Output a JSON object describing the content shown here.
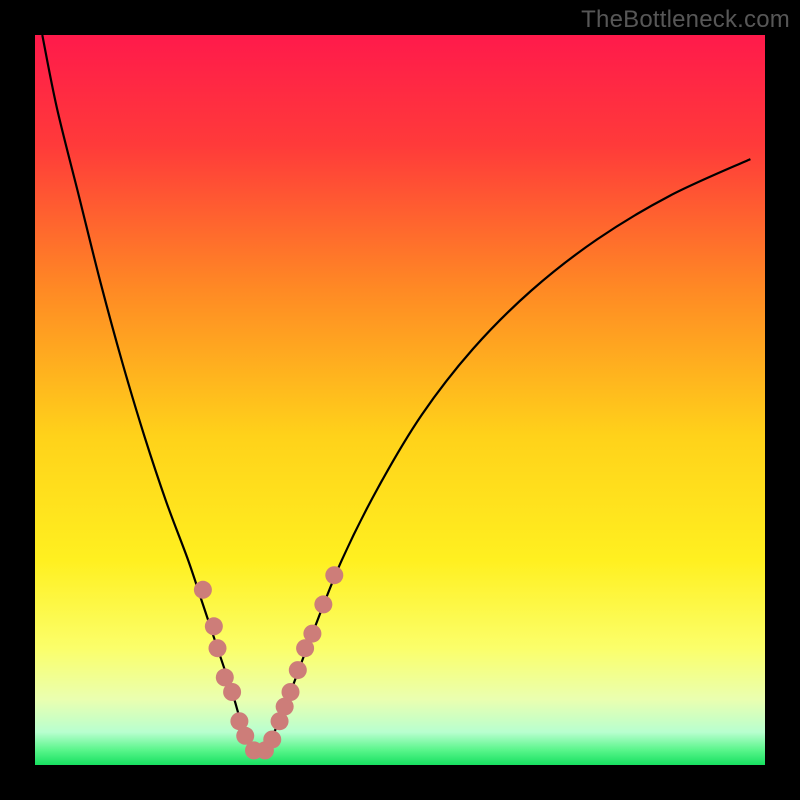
{
  "watermark": "TheBottleneck.com",
  "colors": {
    "frame": "#000000",
    "curve_stroke": "#000000",
    "marker_fill": "#cd7d79",
    "marker_stroke": "#cd7d79",
    "gradient_stops": [
      {
        "offset": 0.0,
        "color": "#ff1a4b"
      },
      {
        "offset": 0.15,
        "color": "#ff3a3a"
      },
      {
        "offset": 0.35,
        "color": "#ff8a24"
      },
      {
        "offset": 0.55,
        "color": "#ffd21a"
      },
      {
        "offset": 0.72,
        "color": "#fff020"
      },
      {
        "offset": 0.84,
        "color": "#fbff6a"
      },
      {
        "offset": 0.91,
        "color": "#eaffb0"
      },
      {
        "offset": 0.955,
        "color": "#b8ffcf"
      },
      {
        "offset": 0.98,
        "color": "#58f58a"
      },
      {
        "offset": 1.0,
        "color": "#17e060"
      }
    ]
  },
  "chart_data": {
    "type": "line",
    "title": "",
    "xlabel": "",
    "ylabel": "",
    "xlim": [
      0,
      100
    ],
    "ylim": [
      0,
      100
    ],
    "series": [
      {
        "name": "bottleneck-curve",
        "x": [
          1,
          3,
          6,
          9,
          12,
          15,
          18,
          21,
          23,
          25,
          27,
          28.5,
          30,
          31.5,
          33,
          35,
          38,
          42,
          47,
          53,
          60,
          68,
          77,
          87,
          98
        ],
        "y": [
          100,
          90,
          78,
          66,
          55,
          45,
          36,
          28,
          22,
          16,
          10,
          5,
          2,
          2,
          5,
          10,
          18,
          28,
          38,
          48,
          57,
          65,
          72,
          78,
          83
        ]
      }
    ],
    "markers": {
      "name": "highlighted-points",
      "points": [
        {
          "x": 23.0,
          "y": 24
        },
        {
          "x": 24.5,
          "y": 19
        },
        {
          "x": 25.0,
          "y": 16
        },
        {
          "x": 26.0,
          "y": 12
        },
        {
          "x": 27.0,
          "y": 10
        },
        {
          "x": 28.0,
          "y": 6
        },
        {
          "x": 28.8,
          "y": 4
        },
        {
          "x": 30.0,
          "y": 2
        },
        {
          "x": 31.5,
          "y": 2
        },
        {
          "x": 32.5,
          "y": 3.5
        },
        {
          "x": 33.5,
          "y": 6
        },
        {
          "x": 34.2,
          "y": 8
        },
        {
          "x": 35.0,
          "y": 10
        },
        {
          "x": 36.0,
          "y": 13
        },
        {
          "x": 37.0,
          "y": 16
        },
        {
          "x": 38.0,
          "y": 18
        },
        {
          "x": 39.5,
          "y": 22
        },
        {
          "x": 41.0,
          "y": 26
        }
      ]
    }
  }
}
